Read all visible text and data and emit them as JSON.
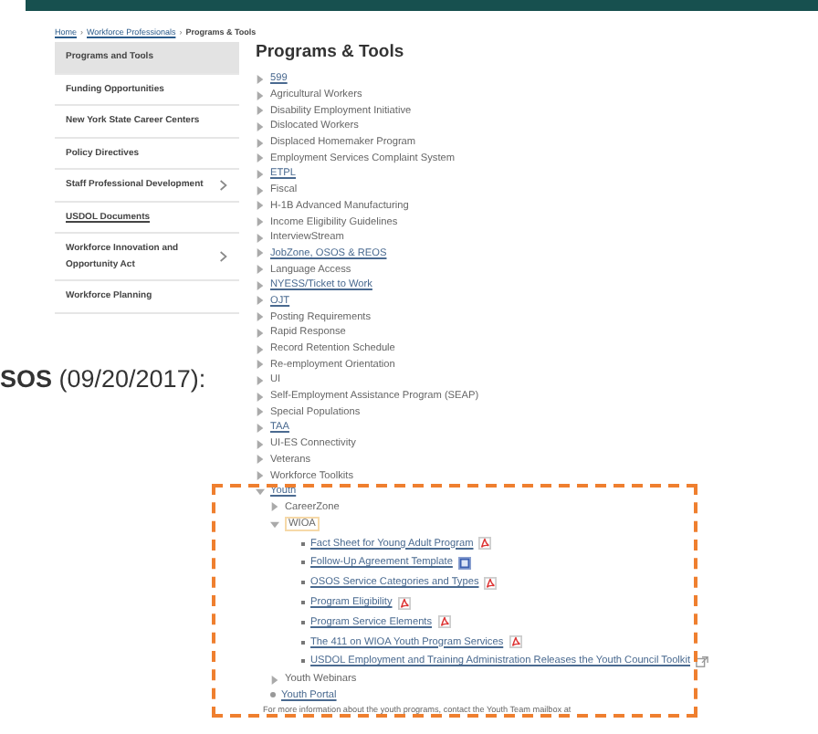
{
  "breadcrumb": [
    {
      "label": "Home",
      "kind": "link"
    },
    {
      "label": "›",
      "kind": "separator"
    },
    {
      "label": "Workforce Professionals",
      "kind": "link"
    },
    {
      "label": "›",
      "kind": "separator"
    },
    {
      "label": "Programs & Tools",
      "kind": "current"
    }
  ],
  "sidebar": {
    "items": [
      {
        "label": "Programs and Tools",
        "selected": true,
        "submenu": false,
        "link": false
      },
      {
        "label": "Funding Opportunities",
        "selected": false,
        "submenu": false,
        "link": false
      },
      {
        "label": "New York State Career Centers",
        "selected": false,
        "submenu": false,
        "link": false
      },
      {
        "label": "Policy Directives",
        "selected": false,
        "submenu": false,
        "link": false
      },
      {
        "label": "Staff Professional Development",
        "selected": false,
        "submenu": true,
        "link": false
      },
      {
        "label": "USDOL Documents",
        "selected": false,
        "submenu": false,
        "link": true
      },
      {
        "label": "Workforce Innovation and Opportunity Act",
        "selected": false,
        "submenu": true,
        "link": false
      },
      {
        "label": "Workforce Planning",
        "selected": false,
        "submenu": false,
        "link": false
      }
    ]
  },
  "backdrop_text": "**SOS** (09/20/2017):",
  "main": {
    "title": "Programs & Tools",
    "items": [
      {
        "label": "599",
        "link": true,
        "expanded": false
      },
      {
        "label": "Agricultural Workers",
        "link": false,
        "expanded": false
      },
      {
        "label": "Disability Employment Initiative",
        "link": false,
        "expanded": false
      },
      {
        "label": "Dislocated Workers",
        "link": false,
        "expanded": false
      },
      {
        "label": "Displaced Homemaker Program",
        "link": false,
        "expanded": false
      },
      {
        "label": "Employment Services Complaint System",
        "link": false,
        "expanded": false
      },
      {
        "label": "ETPL",
        "link": true,
        "expanded": false
      },
      {
        "label": "Fiscal",
        "link": false,
        "expanded": false
      },
      {
        "label": "H-1B Advanced Manufacturing",
        "link": false,
        "expanded": false
      },
      {
        "label": "Income Eligibility Guidelines",
        "link": false,
        "expanded": false
      },
      {
        "label": "InterviewStream",
        "link": false,
        "expanded": false
      },
      {
        "label": "JobZone, OSOS & REOS",
        "link": true,
        "expanded": false
      },
      {
        "label": "Language Access",
        "link": false,
        "expanded": false
      },
      {
        "label": "NYESS/Ticket to Work",
        "link": true,
        "expanded": false
      },
      {
        "label": "OJT",
        "link": true,
        "expanded": false
      },
      {
        "label": "Posting Requirements",
        "link": false,
        "expanded": false
      },
      {
        "label": "Rapid Response",
        "link": false,
        "expanded": false
      },
      {
        "label": "Record Retention Schedule",
        "link": false,
        "expanded": false
      },
      {
        "label": "Re-employment Orientation",
        "link": false,
        "expanded": false
      },
      {
        "label": "UI",
        "link": false,
        "expanded": false
      },
      {
        "label": "Self-Employment Assistance Program (SEAP)",
        "link": false,
        "expanded": false
      },
      {
        "label": "Special Populations",
        "link": false,
        "expanded": false
      },
      {
        "label": "TAA",
        "link": true,
        "expanded": false
      },
      {
        "label": "UI-ES Connectivity",
        "link": false,
        "expanded": false
      },
      {
        "label": "Veterans",
        "link": false,
        "expanded": false
      },
      {
        "label": "Workforce Toolkits",
        "link": false,
        "expanded": false
      },
      {
        "label": "Youth",
        "link": true,
        "expanded": true,
        "children": [
          {
            "label": "CareerZone",
            "kind": "folder",
            "expanded": false
          },
          {
            "label": "WIOA",
            "kind": "folder",
            "expanded": true,
            "children": [
              {
                "label": "Fact Sheet for Young Adult Program",
                "kind": "pdf"
              },
              {
                "label": "Follow-Up Agreement Template",
                "kind": "doc"
              },
              {
                "label": "OSOS Service Categories and Types",
                "kind": "pdf"
              },
              {
                "label": "Program Eligibility",
                "kind": "pdf"
              },
              {
                "label": "Program Service Elements",
                "kind": "pdf"
              },
              {
                "label": "The 411 on WIOA Youth Program Services",
                "kind": "pdf"
              },
              {
                "label": "USDOL Employment and Training Administration Releases the Youth Council Toolkit",
                "kind": "external"
              }
            ]
          },
          {
            "label": "Youth Webinars",
            "kind": "folder",
            "expanded": false
          },
          {
            "label": "Youth Portal",
            "kind": "page",
            "expanded": false
          }
        ]
      }
    ],
    "footer_note": "For more information about the youth programs, contact the Youth Team mailbox at"
  }
}
